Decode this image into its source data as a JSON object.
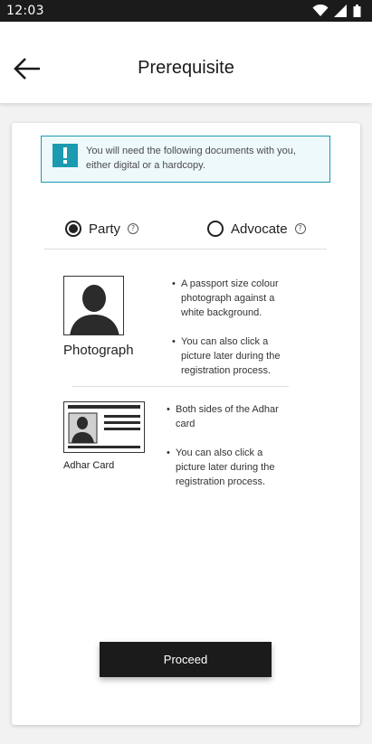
{
  "status_bar": {
    "time": "12:03",
    "icons": [
      "wifi-icon",
      "signal-icon",
      "battery-icon"
    ]
  },
  "header": {
    "title": "Prerequisite",
    "back_icon": "arrow-left-icon"
  },
  "notice": {
    "icon": "exclamation-icon",
    "text": "You will need the following documents with you, either digital or a hardcopy.",
    "accent_color": "#1a9bb0"
  },
  "roles": {
    "selected": "Party",
    "options": [
      {
        "label": "Party",
        "selected": true
      },
      {
        "label": "Advocate",
        "selected": false
      }
    ],
    "help_glyph": "?"
  },
  "documents": [
    {
      "label": "Photograph",
      "icon": "person-photo-icon",
      "bullets": [
        "A passport size colour photograph against a white background.",
        "You can also click a picture later during the registration process."
      ]
    },
    {
      "label": "Adhar Card",
      "icon": "id-card-icon",
      "bullets": [
        "Both sides of the Adhar card",
        "You can also click a picture later during the registration process."
      ]
    }
  ],
  "actions": {
    "proceed_label": "Proceed"
  }
}
